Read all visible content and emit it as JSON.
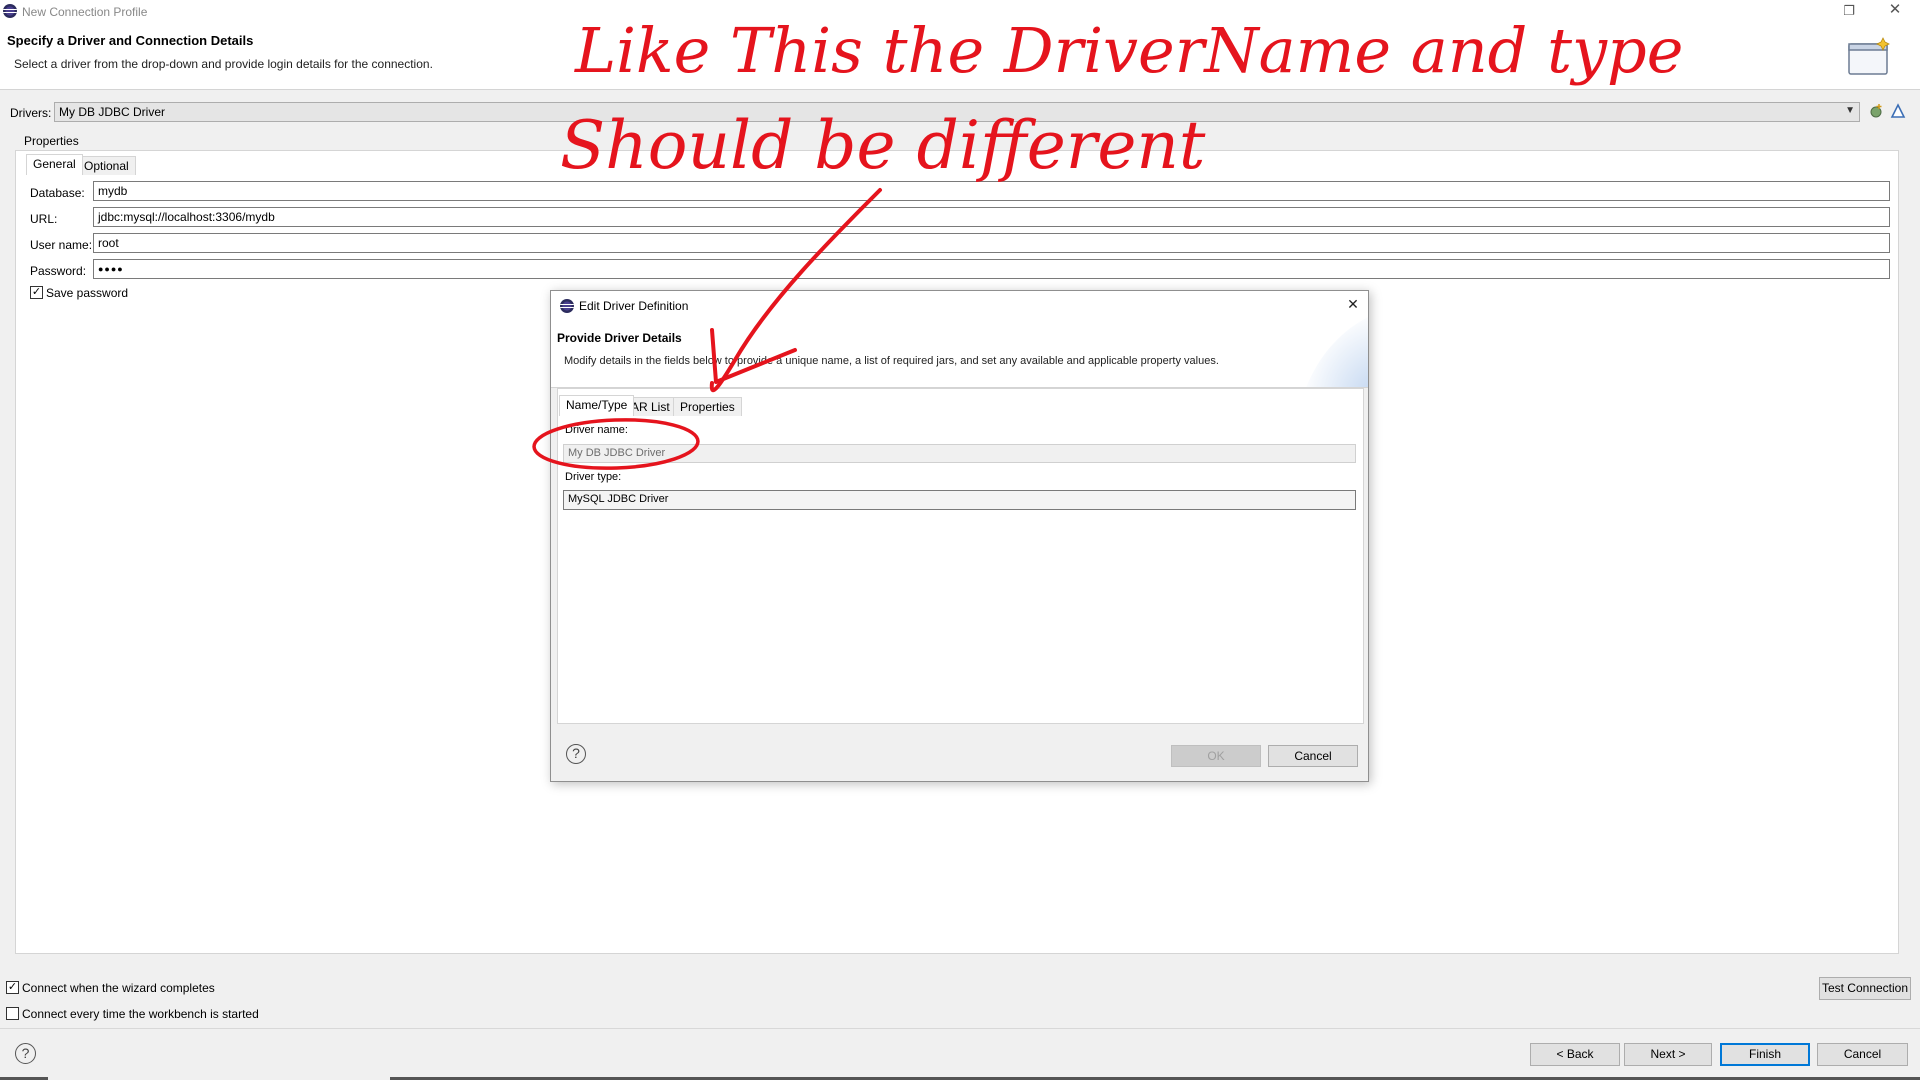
{
  "window": {
    "title": "New Connection Profile",
    "restore_glyph": "❐",
    "close_glyph": "✕"
  },
  "header": {
    "title": "Specify a Driver and Connection Details",
    "description": "Select a driver from the drop-down and provide login details for the connection."
  },
  "drivers": {
    "label": "Drivers:",
    "selected": "My DB JDBC Driver"
  },
  "properties": {
    "label": "Properties",
    "tabs": [
      "General",
      "Optional"
    ],
    "fields": {
      "database_label": "Database:",
      "database_value": "mydb",
      "url_label": "URL:",
      "url_value": "jdbc:mysql://localhost:3306/mydb",
      "username_label": "User name:",
      "username_value": "root",
      "password_label": "Password:",
      "password_value": "●●●●"
    },
    "save_password_label": "Save password",
    "save_password_checked": true
  },
  "options": {
    "connect_on_complete_label": "Connect when the wizard completes",
    "connect_on_complete_checked": true,
    "connect_every_time_label": "Connect every time the workbench is started",
    "connect_every_time_checked": false,
    "check_glyph": "✓"
  },
  "buttons": {
    "test_connection": "Test Connection",
    "back": "< Back",
    "next": "Next >",
    "finish": "Finish",
    "cancel": "Cancel",
    "help_glyph": "?"
  },
  "dialog": {
    "title": "Edit Driver Definition",
    "heading": "Provide Driver Details",
    "description": "Modify details in the fields below to provide a unique name, a list of required jars, and set any available and applicable property values.",
    "tabs": [
      "Name/Type",
      "JAR List",
      "Properties"
    ],
    "driver_name_label": "Driver name:",
    "driver_name_value": "My DB JDBC Driver",
    "driver_type_label": "Driver type:",
    "driver_type_value": "MySQL JDBC Driver",
    "ok": "OK",
    "cancel": "Cancel",
    "close_glyph": "✕",
    "help_glyph": "?"
  },
  "annotation": {
    "line1": "Like This the DriverName and type",
    "line2": "Should be different",
    "color": "#e5141d"
  },
  "icons": {
    "app": "eclipse-icon",
    "new_driver": "new-driver-icon",
    "edit_driver": "edit-driver-icon",
    "wizard_banner": "wizard-banner-icon"
  }
}
